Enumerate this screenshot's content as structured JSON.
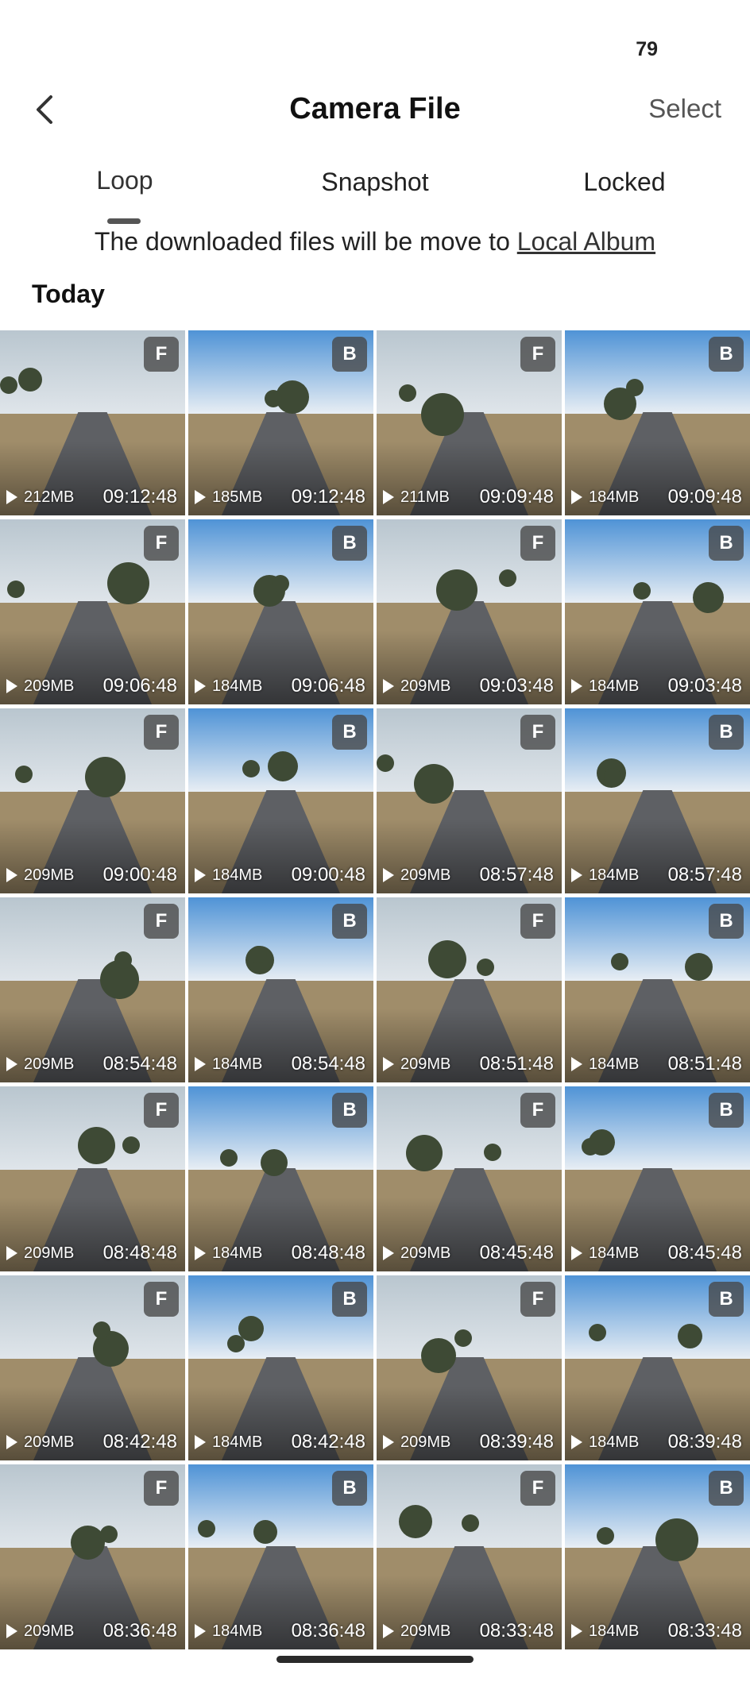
{
  "status": {
    "number": "79"
  },
  "header": {
    "title": "Camera File",
    "select_label": "Select"
  },
  "tabs": [
    {
      "label": "Loop",
      "active": true
    },
    {
      "label": "Snapshot",
      "active": false
    },
    {
      "label": "Locked",
      "active": false
    }
  ],
  "info": {
    "text": "The downloaded files will be move to ",
    "link": "Local Album"
  },
  "section": {
    "title": "Today"
  },
  "files": [
    {
      "badge": "F",
      "size": "212MB",
      "time": "09:12:48"
    },
    {
      "badge": "B",
      "size": "185MB",
      "time": "09:12:48"
    },
    {
      "badge": "F",
      "size": "211MB",
      "time": "09:09:48"
    },
    {
      "badge": "B",
      "size": "184MB",
      "time": "09:09:48"
    },
    {
      "badge": "F",
      "size": "209MB",
      "time": "09:06:48"
    },
    {
      "badge": "B",
      "size": "184MB",
      "time": "09:06:48"
    },
    {
      "badge": "F",
      "size": "209MB",
      "time": "09:03:48"
    },
    {
      "badge": "B",
      "size": "184MB",
      "time": "09:03:48"
    },
    {
      "badge": "F",
      "size": "209MB",
      "time": "09:00:48"
    },
    {
      "badge": "B",
      "size": "184MB",
      "time": "09:00:48"
    },
    {
      "badge": "F",
      "size": "209MB",
      "time": "08:57:48"
    },
    {
      "badge": "B",
      "size": "184MB",
      "time": "08:57:48"
    },
    {
      "badge": "F",
      "size": "209MB",
      "time": "08:54:48"
    },
    {
      "badge": "B",
      "size": "184MB",
      "time": "08:54:48"
    },
    {
      "badge": "F",
      "size": "209MB",
      "time": "08:51:48"
    },
    {
      "badge": "B",
      "size": "184MB",
      "time": "08:51:48"
    },
    {
      "badge": "F",
      "size": "209MB",
      "time": "08:48:48"
    },
    {
      "badge": "B",
      "size": "184MB",
      "time": "08:48:48"
    },
    {
      "badge": "F",
      "size": "209MB",
      "time": "08:45:48"
    },
    {
      "badge": "B",
      "size": "184MB",
      "time": "08:45:48"
    },
    {
      "badge": "F",
      "size": "209MB",
      "time": "08:42:48"
    },
    {
      "badge": "B",
      "size": "184MB",
      "time": "08:42:48"
    },
    {
      "badge": "F",
      "size": "209MB",
      "time": "08:39:48"
    },
    {
      "badge": "B",
      "size": "184MB",
      "time": "08:39:48"
    },
    {
      "badge": "F",
      "size": "209MB",
      "time": "08:36:48"
    },
    {
      "badge": "B",
      "size": "184MB",
      "time": "08:36:48"
    },
    {
      "badge": "F",
      "size": "209MB",
      "time": "08:33:48"
    },
    {
      "badge": "B",
      "size": "184MB",
      "time": "08:33:48"
    }
  ],
  "colors": {
    "sky_front": "#b9c6cf",
    "sky_back": "#4f93d6",
    "road": "#5e6064",
    "grass": "#a08d6a",
    "tree": "#3e4a35",
    "badge_bg": "#464646"
  }
}
